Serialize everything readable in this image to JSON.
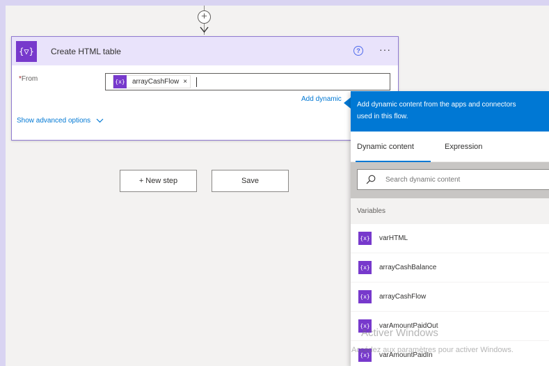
{
  "card": {
    "title": "Create HTML table",
    "icon": "variable-icon",
    "icon_glyph": "{▽}",
    "from_label": "From",
    "required_marker": "*",
    "token": {
      "glyph": "{x}",
      "label": "arrayCashFlow",
      "remove": "×"
    },
    "add_dynamic_label": "Add dynamic",
    "show_advanced": "Show advanced options",
    "help_glyph": "?",
    "more_glyph": "···"
  },
  "connector": {
    "insert_glyph": "+"
  },
  "buttons": {
    "new_step": "+ New step",
    "save": "Save"
  },
  "panel": {
    "header_line1": "Add dynamic content from the apps and connectors",
    "header_line2": "used in this flow.",
    "tabs": [
      "Dynamic content",
      "Expression"
    ],
    "search_placeholder": "Search dynamic content",
    "section": "Variables",
    "var_glyph": "{x}",
    "variables": [
      "varHTML",
      "arrayCashBalance",
      "arrayCashFlow",
      "varAmountPaidOut",
      "varAmountPaidIn"
    ]
  },
  "watermark": {
    "line1": "Activer Windows",
    "line2": "Accédez aux paramètres pour activer Windows."
  },
  "colors": {
    "accent_purple": "#7739cc",
    "header_lavender": "#e9e3fb",
    "panel_blue": "#0078d4",
    "background": "#d9d4f2"
  }
}
